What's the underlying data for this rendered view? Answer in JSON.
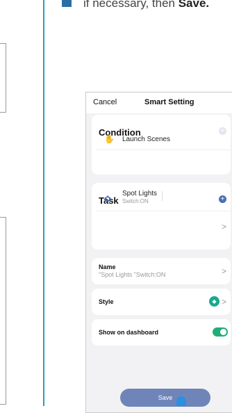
{
  "instruction": {
    "prefix": "if necessary, then ",
    "bold": "Save."
  },
  "phone": {
    "header": {
      "cancel": "Cancel",
      "title": "Smart Setting"
    },
    "condition": {
      "title": "Condition",
      "add_icon": "plus-icon",
      "item": {
        "icon": "hand-icon",
        "label": "Launch Scenes"
      }
    },
    "task": {
      "title": "Task",
      "add_icon": "plus-icon",
      "item": {
        "icon": "bulb-icon",
        "label": "Spot Lights",
        "sub": "Switch:ON",
        "chevron": ">"
      }
    },
    "name_row": {
      "label": "Name",
      "value": "\"Spot Lights \"Switch:ON",
      "chevron": ">"
    },
    "style_row": {
      "label": "Style",
      "icon": "style-icon",
      "chevron": ">"
    },
    "dashboard_row": {
      "label": "Show on dashboard",
      "toggle_on": true
    },
    "save_button": "Save"
  },
  "colors": {
    "accent_blue": "#4a6fb5",
    "save_button": "#6f85b9",
    "toggle_on": "#1fae79",
    "style_badge": "#19a98e",
    "divider_line": "#2e9bbd"
  }
}
